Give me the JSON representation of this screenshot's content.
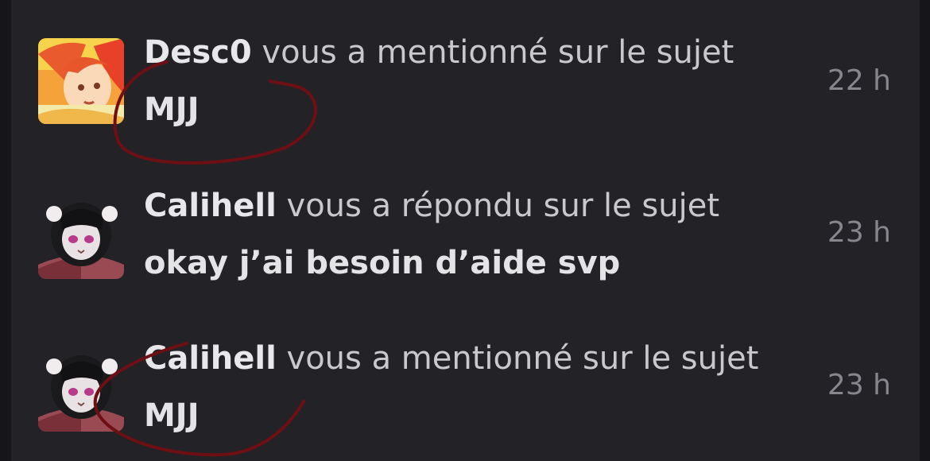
{
  "notifications": [
    {
      "user": "Desc0",
      "action": "vous a mentionné sur le sujet",
      "topic": "MJJ",
      "time": "22 h",
      "avatar_icon": "orange-character-avatar"
    },
    {
      "user": "Calihell",
      "action": "vous a répondu sur le sujet",
      "topic": "okay j’ai besoin d’aide svp",
      "time": "23 h",
      "avatar_icon": "dark-hair-character-avatar"
    },
    {
      "user": "Calihell",
      "action": "vous a mentionné sur le sujet",
      "topic": "MJJ",
      "time": "23 h",
      "avatar_icon": "dark-hair-character-avatar"
    }
  ],
  "colors": {
    "background": "#16161a",
    "panel": "#232226",
    "text": "#c9c9cd",
    "time": "#86868c",
    "annotation": "#6e0f14"
  }
}
